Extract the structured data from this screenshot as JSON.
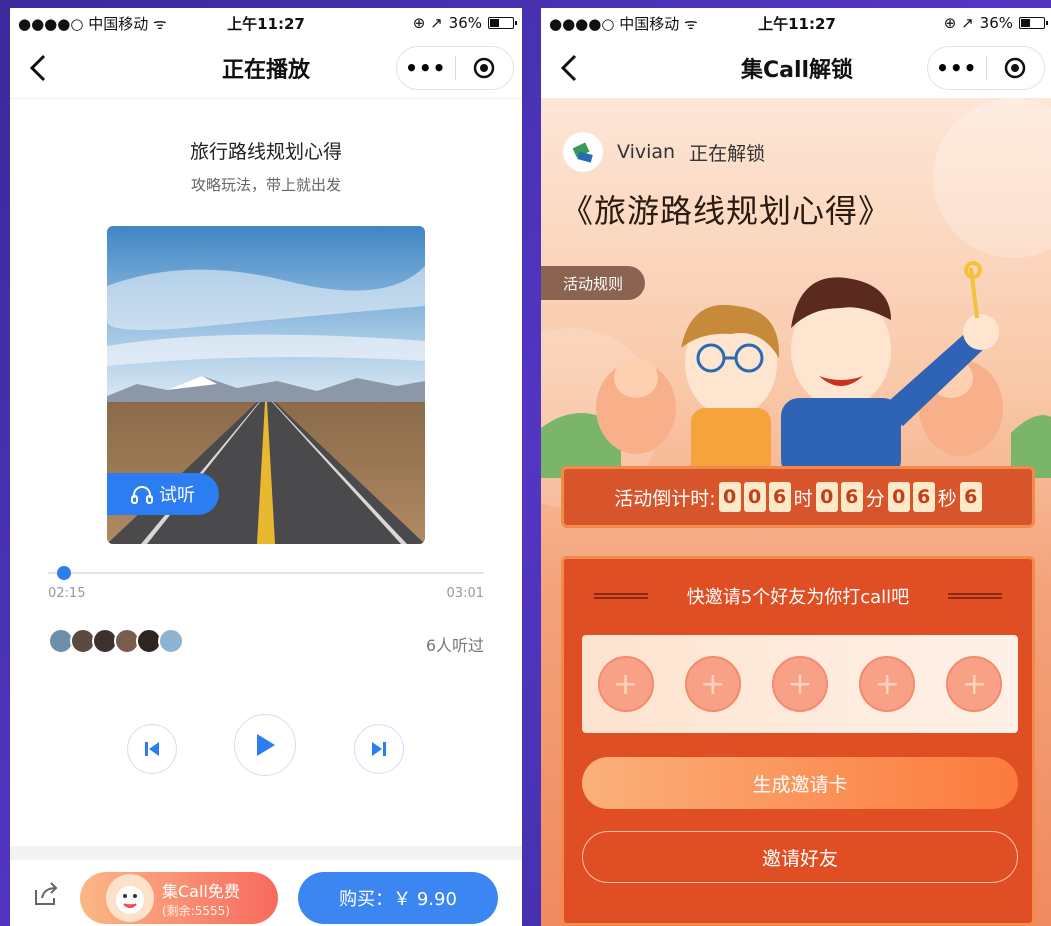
{
  "left": {
    "status": {
      "carrier": "●●●●○ 中国移动 ᯤ",
      "time": "上午11:27",
      "battery": "36%"
    },
    "nav": {
      "title": "正在播放",
      "more": "•••"
    },
    "track": {
      "title": "旅行路线规划心得",
      "subtitle": "攻略玩法，带上就出发"
    },
    "trial_label": "试听",
    "progress": {
      "current": "02:15",
      "total": "03:01",
      "fraction": 0.02
    },
    "listeners": "6人听过",
    "bottom": {
      "free_title": "集Call免费",
      "free_sub": "(剩余:5555)",
      "buy_label": "购买：￥ 9.90"
    }
  },
  "right": {
    "status": {
      "carrier": "●●●●○ 中国移动 ᯤ",
      "time": "上午11:27",
      "battery": "36%"
    },
    "nav": {
      "title": "集Call解锁",
      "more": "•••"
    },
    "user": {
      "name": "Vivian",
      "action": "正在解锁"
    },
    "book_title": "《旅游路线规划心得》",
    "rules_label": "活动规则",
    "countdown": {
      "label": "活动倒计时:",
      "d1": "0",
      "d2": "0",
      "d3": "6",
      "u1": "时",
      "d4": "0",
      "d5": "6",
      "u2": "分",
      "d6": "0",
      "d7": "6",
      "u3": "秒",
      "d8": "6"
    },
    "invite": {
      "heading": "快邀请5个好友为你打call吧",
      "slot_glyph": "+",
      "generate_label": "生成邀请卡",
      "invite_label": "邀请好友"
    }
  },
  "colors": {
    "accent_blue": "#2d7df2",
    "brand_orange": "#e04e24",
    "background_purple": "#4a2fb0"
  }
}
